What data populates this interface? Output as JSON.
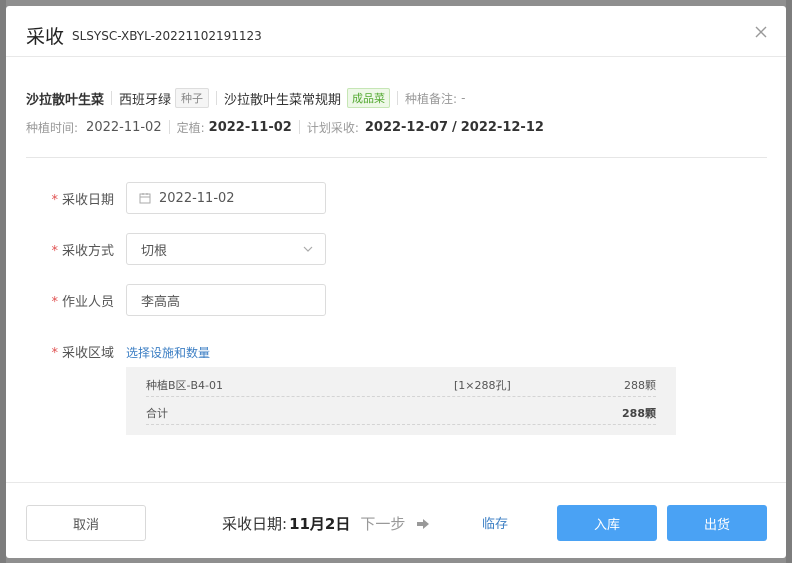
{
  "dialog": {
    "title": "采收",
    "code": "SLSYSC-XBYL-20221102191123"
  },
  "info": {
    "crop": "沙拉散叶生菜",
    "variety": "西班牙绿",
    "variety_tag": "种子",
    "plan": "沙拉散叶生菜常规期",
    "plan_tag": "成品菜",
    "remark_label": "种植备注:",
    "remark_value": "-",
    "plant_time_label": "种植时间:",
    "plant_time": "2022-11-02",
    "fix_label": "定植:",
    "fix_date": "2022-11-02",
    "plan_harvest_label": "计划采收:",
    "plan_harvest_start": "2022-12-07",
    "plan_harvest_slash": "/",
    "plan_harvest_end": "2022-12-12"
  },
  "form": {
    "required_mark": "*",
    "date_label": "采收日期",
    "date_value": "2022-11-02",
    "method_label": "采收方式",
    "method_value": "切根",
    "worker_label": "作业人员",
    "worker_value": "李高高",
    "area_label": "采收区域",
    "area_link": "选择设施和数量"
  },
  "area_rows": [
    {
      "name": "种植B区-B4-01",
      "spec": "[1×288孔]",
      "qty": "288颗"
    },
    {
      "name": "合计",
      "spec": "",
      "qty": "288颗"
    }
  ],
  "footer": {
    "cancel": "取消",
    "date_prefix": "采收日期:",
    "date_value": "11月2日",
    "next_step": "下一步",
    "save": "临存",
    "stock_in": "入库",
    "ship": "出货"
  },
  "colors": {
    "primary_button": "#4aa2f4",
    "link": "#3d7fc4",
    "required": "#e05050",
    "tag_green": "#52a830"
  },
  "icons": [
    "close-icon",
    "calendar-icon",
    "chevron-down-icon",
    "arrow-right-icon"
  ]
}
